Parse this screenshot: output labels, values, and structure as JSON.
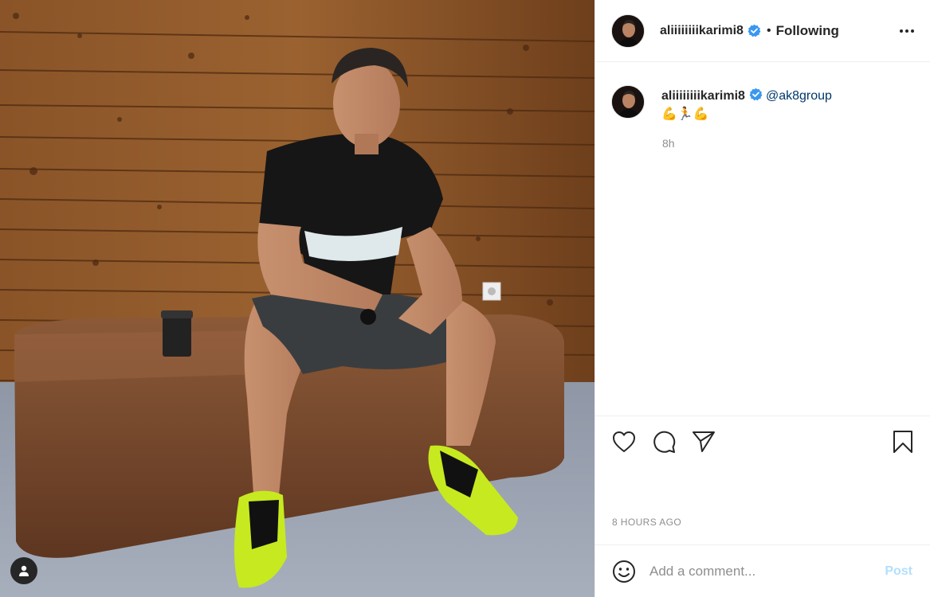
{
  "post": {
    "username": "aliiiiiiiikarimi8",
    "follow_status": "Following",
    "dot": "•",
    "caption_mention": "@ak8group",
    "caption_emoji": "💪🏃💪",
    "caption_time": "8h",
    "time_ago": "8 HOURS AGO"
  },
  "comment": {
    "placeholder": "Add a comment...",
    "post_label": "Post"
  },
  "icons": {
    "verified": "verified-badge-icon",
    "more": "more-options-icon",
    "like": "heart-icon",
    "comment": "comment-bubble-icon",
    "share": "share-paper-plane-icon",
    "save": "bookmark-icon",
    "emoji": "smiley-icon",
    "tag_user": "user-tag-icon"
  },
  "colors": {
    "verified_blue": "#3897f0",
    "mention_link": "#00376b",
    "post_button_disabled": "#b2dffc",
    "muted_text": "#8e8e8e"
  }
}
